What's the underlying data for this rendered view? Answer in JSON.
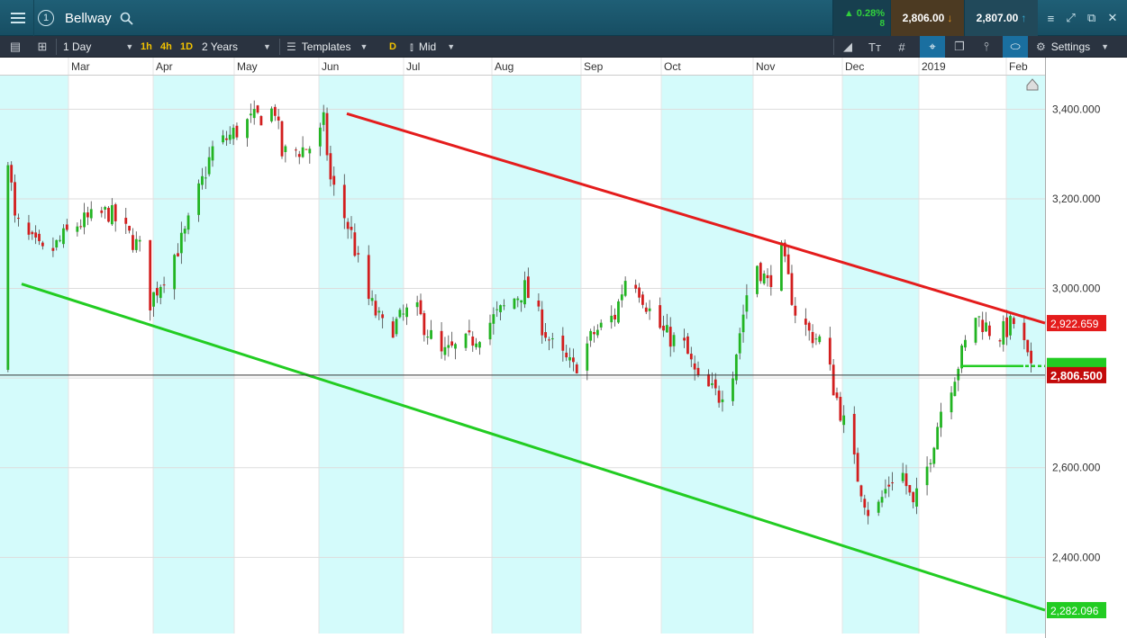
{
  "titlebar": {
    "badge": "1",
    "title": "Bellway",
    "change_pct": "0.28%",
    "change_abs": "8",
    "sell_price": "2,806.00",
    "buy_price": "2,807.00"
  },
  "toolbar": {
    "interval": "1 Day",
    "btn_1h": "1h",
    "btn_4h": "4h",
    "btn_1d": "1D",
    "range": "2 Years",
    "templates": "Templates",
    "btn_d": "D",
    "price_type": "Mid",
    "settings": "Settings"
  },
  "colors": {
    "resistance_line": "#e41c1c",
    "support_line": "#22cc22",
    "up_candle": "#22b422",
    "down_candle": "#d21e1e",
    "shade_band": "#d4fbfb"
  },
  "chart_data": {
    "type": "candlestick",
    "months": [
      "Mar",
      "Apr",
      "May",
      "Jun",
      "Jul",
      "Aug",
      "Sep",
      "Oct",
      "Nov",
      "Dec",
      "2019",
      "Feb"
    ],
    "y_ticks": [
      "3,400.000",
      "3,200.000",
      "3,000.000",
      "2,800.000",
      "2,600.000",
      "2,400.000"
    ],
    "ylim": [
      2230,
      3475
    ],
    "current_price": "2,806.500",
    "resistance_label": "2,922.659",
    "support_label": "2,282.096",
    "approx_closes": [
      [
        1,
        3300
      ],
      [
        3,
        3150
      ],
      [
        8,
        3100
      ],
      [
        12,
        3070
      ],
      [
        20,
        3140
      ],
      [
        30,
        3170
      ],
      [
        40,
        3080
      ],
      [
        42,
        2970
      ],
      [
        52,
        3120
      ],
      [
        60,
        3310
      ],
      [
        70,
        3370
      ],
      [
        78,
        3400
      ],
      [
        80,
        3300
      ],
      [
        90,
        3320
      ],
      [
        92,
        3370
      ],
      [
        94,
        3240
      ],
      [
        100,
        3120
      ],
      [
        104,
        2990
      ],
      [
        110,
        2900
      ],
      [
        118,
        2960
      ],
      [
        126,
        2850
      ],
      [
        134,
        2880
      ],
      [
        142,
        2940
      ],
      [
        150,
        3000
      ],
      [
        158,
        2870
      ],
      [
        164,
        2820
      ],
      [
        170,
        2900
      ],
      [
        176,
        2940
      ],
      [
        180,
        3050
      ],
      [
        186,
        2950
      ],
      [
        190,
        2900
      ],
      [
        196,
        2870
      ],
      [
        200,
        2790
      ],
      [
        206,
        2760
      ],
      [
        210,
        2820
      ],
      [
        216,
        3070
      ],
      [
        220,
        3010
      ],
      [
        224,
        3080
      ],
      [
        228,
        2950
      ],
      [
        232,
        2900
      ],
      [
        236,
        2880
      ],
      [
        239,
        2780
      ],
      [
        242,
        2700
      ],
      [
        246,
        2580
      ],
      [
        250,
        2480
      ],
      [
        254,
        2550
      ],
      [
        258,
        2610
      ],
      [
        262,
        2510
      ],
      [
        266,
        2600
      ],
      [
        270,
        2730
      ],
      [
        274,
        2810
      ],
      [
        280,
        2940
      ],
      [
        286,
        2890
      ],
      [
        292,
        2930
      ],
      [
        296,
        2810
      ]
    ]
  }
}
